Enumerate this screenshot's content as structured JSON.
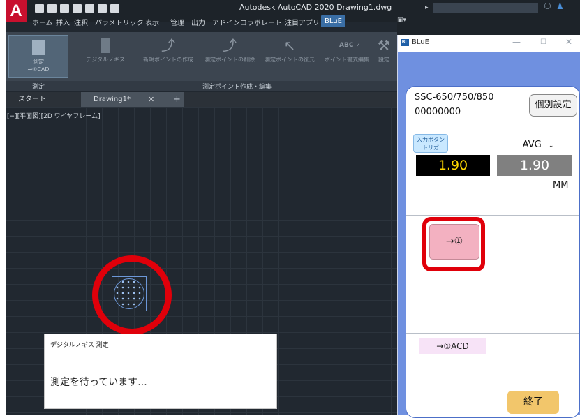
{
  "acad": {
    "logo": "A",
    "title": "Autodesk AutoCAD 2020   Drawing1.dwg",
    "ribbon_tabs": [
      "ホーム",
      "挿入",
      "注釈",
      "パラメトリック",
      "表示",
      "管理",
      "出力",
      "アドイン",
      "コラボレート",
      "注目アプリ",
      "BLuE"
    ],
    "active_tab": "BLuE",
    "ribbon": {
      "measure_btn": "測定\n→①CAD",
      "caliper_btn": "デジタルノギス",
      "new_point": "新規ポイントの作成",
      "delete_point": "測定ポイントの削除",
      "restore_point": "測定ポイントの復元",
      "bulk_edit": "ポイント書式編集",
      "settings": "設定",
      "panel_measure": "測定",
      "panel_points": "測定ポイント作成・編集"
    },
    "doc_tabs": {
      "start": "スタート",
      "drawing": "Drawing1*"
    },
    "view_label": "[−][平面図][2D ワイヤフレーム]",
    "dialog": {
      "title": "デジタルノギス 測定",
      "message": "測定を待っています..."
    }
  },
  "blue": {
    "title": "BLuE",
    "model": "SSC-650/750/850",
    "serial": "00000000",
    "individual_btn": "個別設定",
    "trigger_btn": "入力ボタン\nトリガ",
    "avg_select": "AVG",
    "value_main": "1.90",
    "value_sub": "1.90",
    "unit": "MM",
    "arrow_btn": "→①",
    "acd_btn": "→①ACD",
    "end_btn": "終了"
  },
  "colors": {
    "acad_bg": "#212830",
    "ribbon_active": "#3a6ea5",
    "blue_bg": "#6f90e0",
    "highlight_red": "#e0000a",
    "value_yellow": "#ffd900",
    "end_button": "#f2c66b"
  }
}
